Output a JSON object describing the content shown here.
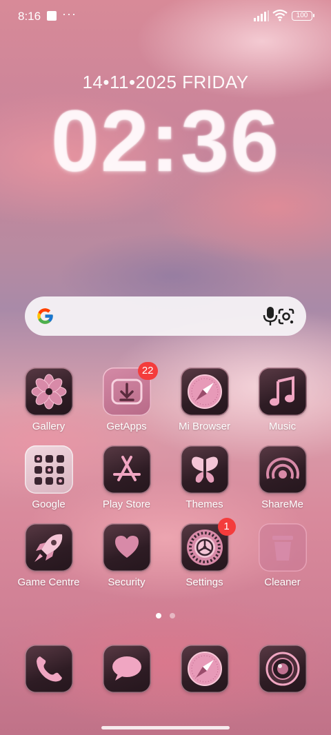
{
  "status_bar": {
    "time": "8:16",
    "dots": "···",
    "battery": "100"
  },
  "clock_widget": {
    "date": "14•11•2025 FRIDAY",
    "time": "02:36"
  },
  "search": {
    "icon_left": "google-g-icon",
    "icons_right": [
      "microphone-icon",
      "google-lens-icon"
    ]
  },
  "apps": [
    {
      "label": "Gallery"
    },
    {
      "label": "GetApps",
      "badge": "22"
    },
    {
      "label": "Mi Browser"
    },
    {
      "label": "Music"
    },
    {
      "label": "Google"
    },
    {
      "label": "Play Store"
    },
    {
      "label": "Themes"
    },
    {
      "label": "ShareMe"
    },
    {
      "label": "Game Centre"
    },
    {
      "label": "Security"
    },
    {
      "label": "Settings",
      "badge": "1"
    },
    {
      "label": "Cleaner"
    }
  ],
  "pagination": {
    "pages": 2,
    "current": 1
  },
  "dock": [
    {
      "icon": "phone-icon"
    },
    {
      "icon": "messages-icon"
    },
    {
      "icon": "browser-icon"
    },
    {
      "icon": "camera-icon"
    }
  ],
  "colors": {
    "icon_border": "#ffbed2",
    "badge": "#f43c3c",
    "accent_pink": "#f4a6c4"
  }
}
